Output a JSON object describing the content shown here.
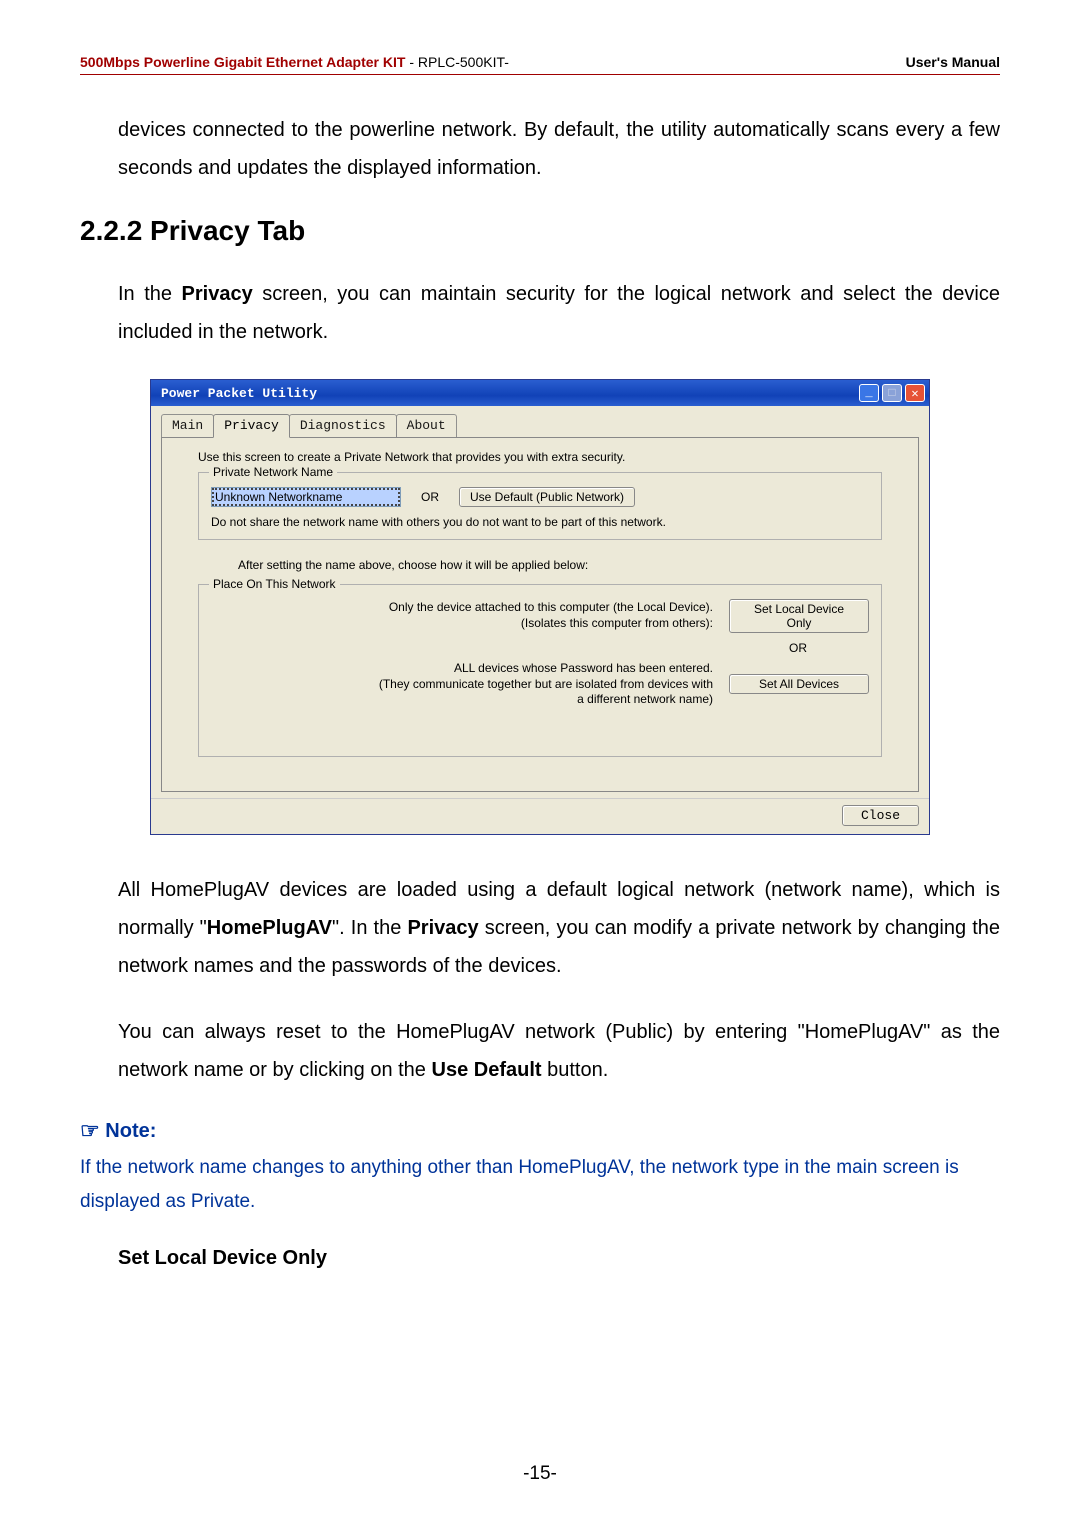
{
  "header": {
    "left": "500Mbps Powerline Gigabit Ethernet Adapter KIT",
    "mid_prefix": " - ",
    "mid": "RPLC-500KIT-",
    "right": "User's Manual"
  },
  "para_intro": "devices connected to the powerline network. By default, the utility automatically scans every a few seconds and updates the displayed information.",
  "section_heading": "2.2.2 Privacy Tab",
  "para_privacy_1a": "In the ",
  "para_privacy_1b": "Privacy",
  "para_privacy_1c": " screen, you can maintain security for the logical network and select the device included in the network.",
  "win": {
    "title": "Power Packet Utility",
    "tabs": {
      "main": "Main",
      "privacy": "Privacy",
      "diagnostics": "Diagnostics",
      "about": "About"
    },
    "intro": "Use this screen to create a Private Network that provides you with extra security.",
    "group1_title": "Private Network Name",
    "network_name_value": "Unknown Networkname",
    "or": "OR",
    "use_default_btn": "Use Default (Public Network)",
    "warn": "Do not share the network name with others you do not want to be part of this network.",
    "mid_line": "After setting the name above, choose how it will be applied below:",
    "group2_title": "Place On This Network",
    "desc_local_1": "Only the device attached to this computer (the Local Device).",
    "desc_local_2": "(Isolates this computer from others):",
    "btn_local": "Set Local Device Only",
    "or2": "OR",
    "desc_all_1": "ALL devices whose Password has been entered.",
    "desc_all_2": "(They communicate together but are isolated from devices with",
    "desc_all_3": "a different network name)",
    "btn_all": "Set All Devices",
    "close": "Close"
  },
  "para_after_1a": "All HomePlugAV devices are loaded using a default logical network (network name), which is normally \"",
  "para_after_1b": "HomePlugAV",
  "para_after_1c": "\". In the ",
  "para_after_1d": "Privacy",
  "para_after_1e": " screen, you can modify a private network by changing the network names and the passwords of the devices.",
  "para_after_2a": "You can always reset to the HomePlugAV network (Public) by entering \"HomePlugAV\" as the network name or by clicking on the ",
  "para_after_2b": "Use Default",
  "para_after_2c": " button.",
  "note_heading": "Note:",
  "note_text": "If the network name changes to anything other than HomePlugAV, the network type in the main screen is displayed as Private.",
  "sub_heading": "Set Local Device Only",
  "page_num": "-15-"
}
